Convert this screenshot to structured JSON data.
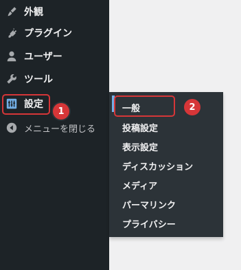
{
  "sidebar": {
    "items": [
      {
        "label": "外観",
        "icon": "paintbrush-icon"
      },
      {
        "label": "プラグイン",
        "icon": "plugin-icon"
      },
      {
        "label": "ユーザー",
        "icon": "user-icon"
      },
      {
        "label": "ツール",
        "icon": "wrench-icon"
      },
      {
        "label": "設定",
        "icon": "settings-icon"
      },
      {
        "label": "メニューを閉じる",
        "icon": "collapse-icon"
      }
    ]
  },
  "submenu": {
    "items": [
      {
        "label": "一般"
      },
      {
        "label": "投稿設定"
      },
      {
        "label": "表示設定"
      },
      {
        "label": "ディスカッション"
      },
      {
        "label": "メディア"
      },
      {
        "label": "パーマリンク"
      },
      {
        "label": "プライバシー"
      }
    ]
  },
  "annotations": {
    "badge1": "1",
    "badge2": "2"
  },
  "colors": {
    "sidebar_bg": "#1d2327",
    "submenu_bg": "#2c3338",
    "accent": "#72aee6",
    "annotation_red": "#d63638"
  }
}
